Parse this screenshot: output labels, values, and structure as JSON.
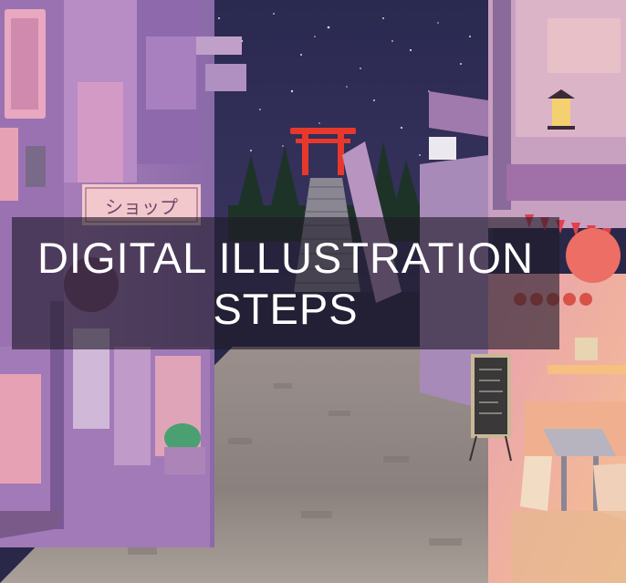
{
  "title": {
    "line1": "DIGITAL ILLUSTRATION",
    "line2": "STEPS"
  },
  "signs": {
    "shop": "ショップ"
  },
  "colors": {
    "sky": "#2e2c55",
    "torii": "#e8382c",
    "building_left": "#a07ab8",
    "building_pink": "#e6a2b4",
    "street": "#8d8580",
    "shop_warm": "#f2b48a",
    "overlay": "#1e1a28"
  }
}
